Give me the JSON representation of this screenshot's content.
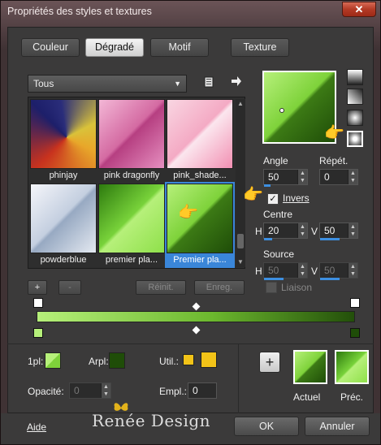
{
  "window": {
    "title": "Propriétés des styles et textures",
    "close_glyph": "✕"
  },
  "tabs": [
    {
      "label": "Couleur",
      "active": false
    },
    {
      "label": "Dégradé",
      "active": true
    },
    {
      "label": "Motif",
      "active": false
    },
    {
      "label": "Texture",
      "active": false
    }
  ],
  "gallery": {
    "category": "Tous",
    "items": [
      {
        "caption": "phinjay"
      },
      {
        "caption": "pink dragonfly"
      },
      {
        "caption": "pink_shade..."
      },
      {
        "caption": "powderblue"
      },
      {
        "caption": "premier pla..."
      },
      {
        "caption": "Premier pla...",
        "selected": true
      }
    ],
    "add_glyph": "+",
    "remove_glyph": "-",
    "reset_label": "Réinit.",
    "save_label": "Enreg."
  },
  "controls": {
    "angle_label": "Angle",
    "angle_value": "50",
    "repeat_label": "Répét.",
    "repeat_value": "0",
    "invert_label": "Invers",
    "invert_checked": true,
    "center_label": "Centre",
    "center_h_prefix": "H",
    "center_h_value": "20",
    "center_v_prefix": "V",
    "center_v_value": "50",
    "source_label": "Source",
    "source_h_prefix": "H",
    "source_h_value": "50",
    "source_v_prefix": "V",
    "source_v_value": "50",
    "link_label": "Liaison"
  },
  "stops": {
    "first_label": "1pl:",
    "arpl_label": "Arpl:",
    "util_label": "Util.:",
    "opacity_label": "Opacité:",
    "opacity_value": "0",
    "empl_label": "Empl.:",
    "empl_value": "0"
  },
  "preview": {
    "add_glyph": "+",
    "current_label": "Actuel",
    "previous_label": "Préc."
  },
  "footer": {
    "help_label": "Aide",
    "ok_label": "OK",
    "cancel_label": "Annuler",
    "watermark": "Renée Design"
  },
  "colors": {
    "gradient_light": "#b6f07a",
    "gradient_dark": "#1f4d08",
    "selection": "#3a86d9",
    "util_swatch": "#f2c318"
  },
  "icons": [
    "dropdown-arrow-icon",
    "folder-icon",
    "right-arrow-icon",
    "pointing-hand-icon",
    "butterfly-icon"
  ]
}
